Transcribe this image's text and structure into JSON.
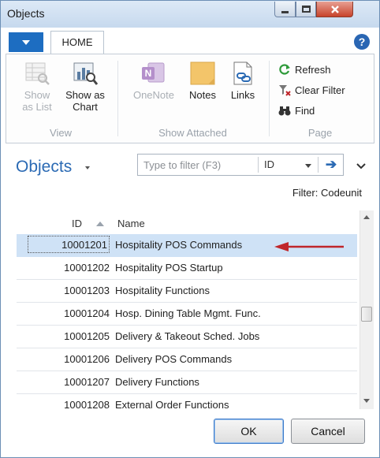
{
  "window": {
    "title": "Objects"
  },
  "ribbon": {
    "tab": "HOME",
    "groups": {
      "view": {
        "label": "View",
        "show_as_list": [
          "Show",
          "as List"
        ],
        "show_as_chart": [
          "Show as",
          "Chart"
        ]
      },
      "show_attached": {
        "label": "Show Attached",
        "onenote": "OneNote",
        "notes": "Notes",
        "links": "Links"
      },
      "page": {
        "label": "Page",
        "refresh": "Refresh",
        "clear_filter": "Clear Filter",
        "find": "Find"
      }
    }
  },
  "page": {
    "title": "Objects",
    "filter": {
      "placeholder": "Type to filter (F3)",
      "field": "ID",
      "status": "Filter: Codeunit"
    }
  },
  "list": {
    "columns": {
      "id": "ID",
      "name": "Name"
    },
    "rows": [
      {
        "id": "10001201",
        "name": "Hospitality POS Commands"
      },
      {
        "id": "10001202",
        "name": "Hospitality POS Startup"
      },
      {
        "id": "10001203",
        "name": "Hospitality Functions"
      },
      {
        "id": "10001204",
        "name": "Hosp. Dining Table Mgmt. Func."
      },
      {
        "id": "10001205",
        "name": "Delivery & Takeout Sched. Jobs"
      },
      {
        "id": "10001206",
        "name": "Delivery POS Commands"
      },
      {
        "id": "10001207",
        "name": "Delivery Functions"
      },
      {
        "id": "10001208",
        "name": "External Order Functions"
      }
    ],
    "selected_index": 0
  },
  "buttons": {
    "ok": "OK",
    "cancel": "Cancel"
  },
  "colors": {
    "accent": "#2b6ab4",
    "selection": "#cfe2f6",
    "annotation_arrow": "#c0262b"
  }
}
